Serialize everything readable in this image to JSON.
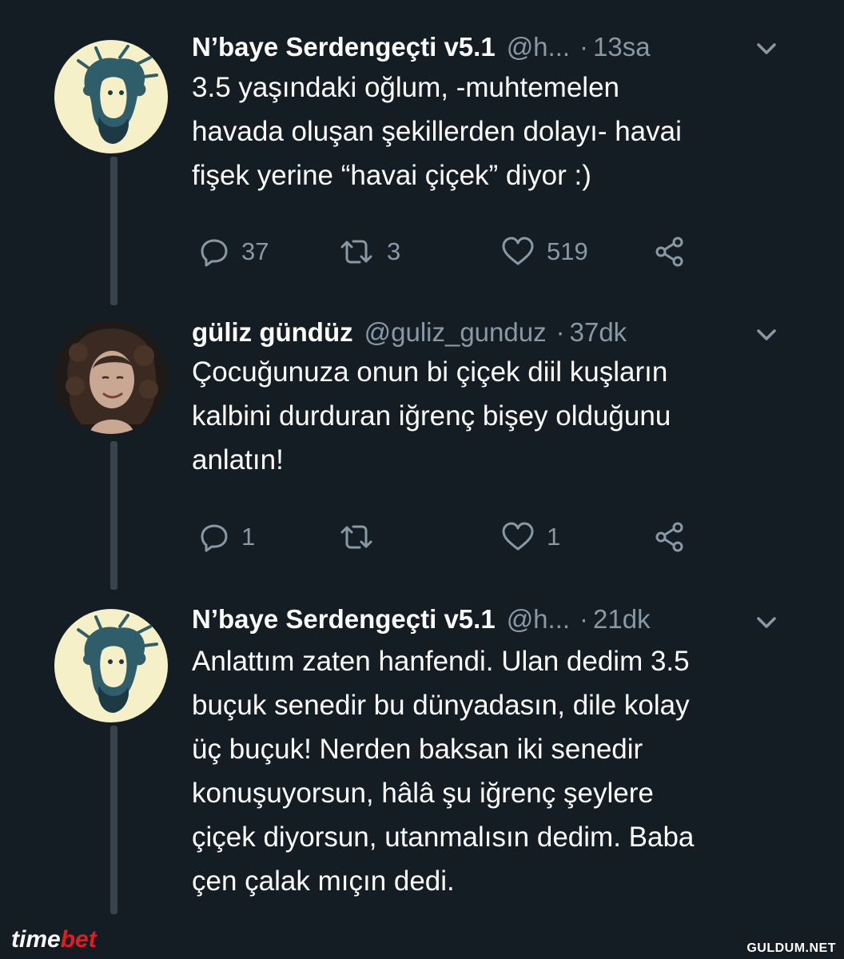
{
  "tweets": [
    {
      "display_name": "N’baye Serdengeçti v5.1",
      "handle": "@h...",
      "separator": "·",
      "time": "13sa",
      "lines": [
        "3.5 yaşındaki oğlum, -muhtemelen",
        "havada oluşan şekillerden dolayı- havai",
        "fişek yerine “havai çiçek” diyor :)"
      ],
      "reply_count": "37",
      "retweet_count": "3",
      "like_count": "519"
    },
    {
      "display_name": "güliz gündüz",
      "handle": "@guliz_gunduz",
      "separator": "·",
      "time": "37dk",
      "lines": [
        "Çocuğunuza onun bi çiçek diil kuşların",
        "kalbini durduran iğrenç bişey olduğunu",
        "anlatın!"
      ],
      "reply_count": "1",
      "retweet_count": "",
      "like_count": "1"
    },
    {
      "display_name": "N’baye Serdengeçti v5.1",
      "handle": "@h...",
      "separator": "·",
      "time": "21dk",
      "lines": [
        "Anlattım zaten hanfendi. Ulan dedim 3.5",
        "buçuk senedir bu dünyadasın, dile kolay",
        "üç buçuk! Nerden baksan iki senedir",
        "konuşuyorsun, hâlâ şu iğrenç şeylere",
        "çiçek diyorsun, utanmalısın dedim. Baba",
        "çen çalak mıçın dedi."
      ]
    }
  ],
  "icons": {
    "reply": "reply-icon",
    "retweet": "retweet-icon",
    "like": "heart-icon",
    "share": "share-icon",
    "more": "chevron-down-icon"
  },
  "colors": {
    "background": "#141c24",
    "secondary_text": "#8899a6",
    "thread_line": "#38444d",
    "avatar_bg_1": "#f6f0c8"
  },
  "watermarks": {
    "left_time": "time",
    "left_bet": "bet",
    "right": "GULDUM.NET"
  }
}
